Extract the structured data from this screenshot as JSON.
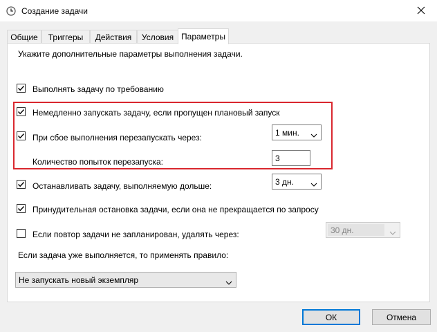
{
  "window": {
    "title": "Создание задачи",
    "icon": "task-scheduler-clock-icon"
  },
  "tabs": [
    {
      "label": "Общие",
      "active": false
    },
    {
      "label": "Триггеры",
      "active": false
    },
    {
      "label": "Действия",
      "active": false
    },
    {
      "label": "Условия",
      "active": false
    },
    {
      "label": "Параметры",
      "active": true
    }
  ],
  "settings": {
    "intro": "Укажите дополнительные параметры выполнения задачи.",
    "run_on_demand": {
      "label": "Выполнять задачу по требованию",
      "checked": true
    },
    "run_missed": {
      "label": "Немедленно запускать задачу, если пропущен плановый запуск",
      "checked": true
    },
    "restart_on_fail": {
      "label": "При сбое выполнения перезапускать через:",
      "checked": true,
      "interval": "1 мин."
    },
    "restart_attempts": {
      "label": "Количество попыток перезапуска:",
      "value": "3"
    },
    "stop_long": {
      "label": "Останавливать задачу, выполняемую дольше:",
      "checked": true,
      "duration": "3 дн."
    },
    "force_stop": {
      "label": "Принудительная остановка задачи, если она не прекращается по запросу",
      "checked": true
    },
    "delete_if_not_scheduled": {
      "label": "Если повтор задачи не запланирован, удалять через:",
      "checked": false,
      "duration": "30 дн."
    },
    "rule_label": "Если задача уже выполняется, то применять правило:",
    "rule_value": "Не запускать новый экземпляр"
  },
  "buttons": {
    "ok": "ОК",
    "cancel": "Отмена"
  },
  "colors": {
    "highlight": "#d9272e",
    "default_button_border": "#0078d7"
  }
}
